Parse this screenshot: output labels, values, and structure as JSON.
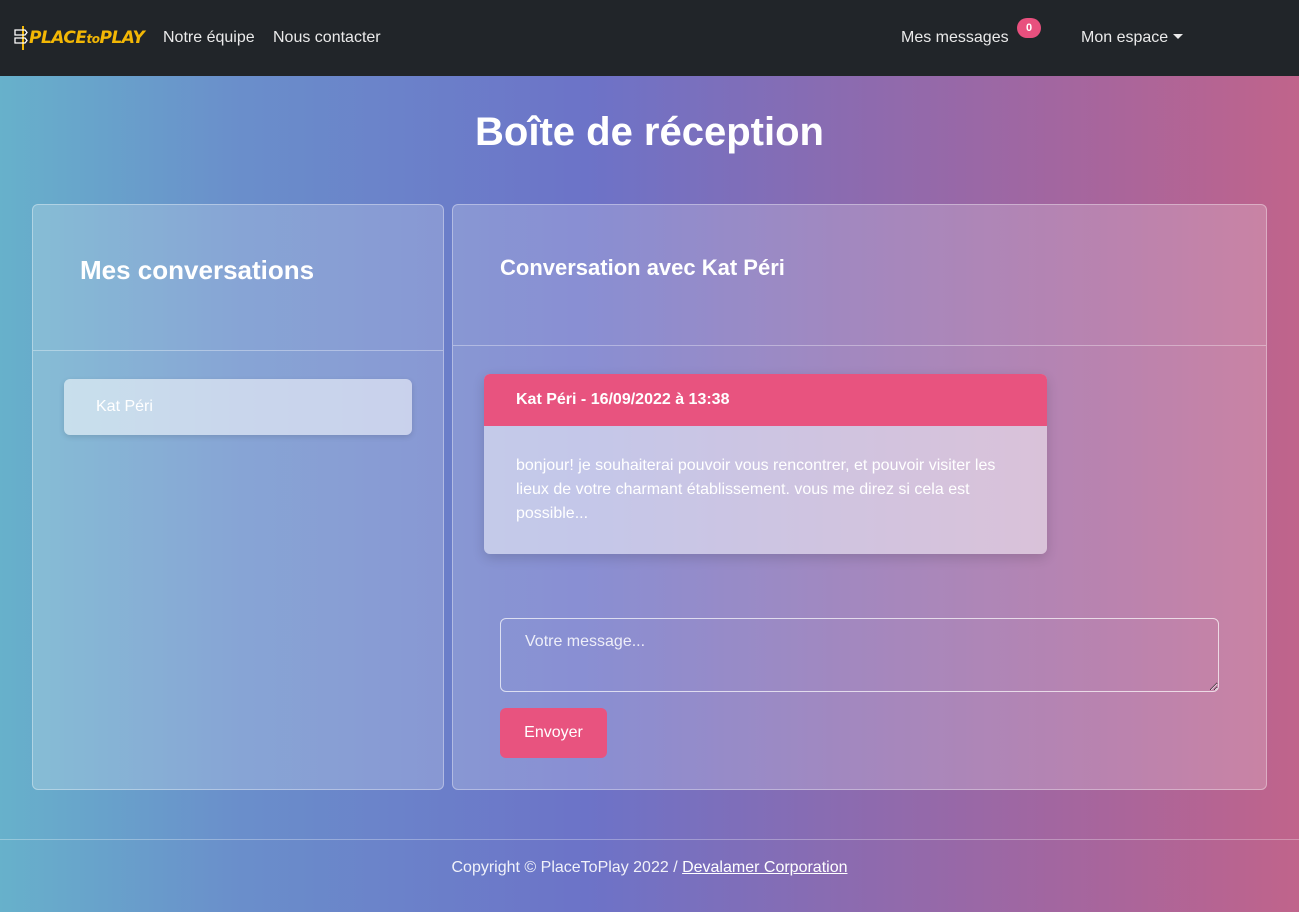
{
  "navbar": {
    "logo": {
      "text_main": "PLACE",
      "text_small": "to",
      "text_end": "PLAY",
      "color": "#f2b705"
    },
    "links": {
      "team": "Notre équipe",
      "contact": "Nous contacter",
      "messages": "Mes messages",
      "account": "Mon espace"
    },
    "messages_badge": "0",
    "background": "#212529"
  },
  "page": {
    "title": "Boîte de réception"
  },
  "conversations": {
    "title": "Mes conversations",
    "items": [
      {
        "name": "Kat Péri"
      }
    ]
  },
  "conversation": {
    "title": "Conversation avec Kat Péri",
    "messages": [
      {
        "header": "Kat Péri - 16/09/2022 à 13:38",
        "body": "bonjour! je souhaiterai pouvoir vous rencontrer, et pouvoir visiter les lieux de votre charmant établissement. vous me direz si cela est possible..."
      }
    ],
    "input_placeholder": "Votre message...",
    "send_label": "Envoyer"
  },
  "footer": {
    "copyright": "Copyright © PlaceToPlay 2022 / ",
    "link": "Devalamer Corporation"
  },
  "colors": {
    "accent": "#e8537f",
    "badge": "#e8507e"
  }
}
